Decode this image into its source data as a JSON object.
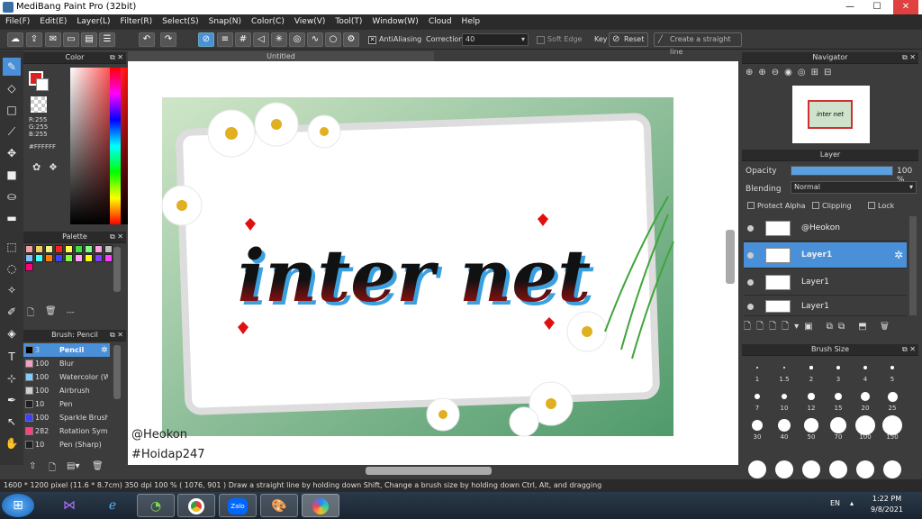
{
  "app": {
    "title": "MediBang Paint Pro (32bit)",
    "controls": [
      "—",
      "☐",
      "✕"
    ]
  },
  "menu": [
    "File(F)",
    "Edit(E)",
    "Layer(L)",
    "Filter(R)",
    "Select(S)",
    "Snap(N)",
    "Color(C)",
    "View(V)",
    "Tool(T)",
    "Window(W)",
    "Cloud",
    "Help"
  ],
  "toolbar": {
    "antialiasing": "AntiAliasing",
    "correction_label": "Correction",
    "correction_value": "40",
    "soft_edge": "Soft Edge",
    "key_label": "Key",
    "reset": "Reset",
    "straight_line": "Create a straight line"
  },
  "color_panel": {
    "title": "Color",
    "r": "R:255",
    "g": "G:255",
    "b": "B:255",
    "hex": "#FFFFFF"
  },
  "palette_panel": {
    "title": "Palette",
    "entry": "---",
    "swatches": [
      "#f4a0a0",
      "#f0d060",
      "#f0f080",
      "#ff2020",
      "#ffff40",
      "#40e040",
      "#80ff80",
      "#ffa0e0",
      "#c0c0c0",
      "#80c0ff",
      "#40ffff",
      "#ff8000",
      "#4040ff",
      "#80ff40",
      "#ffa0ff",
      "#ffff00",
      "#8040ff",
      "#ff40ff",
      "#ff0080"
    ]
  },
  "brush_panel": {
    "title": "Brush: Pencil",
    "items": [
      {
        "size": "3",
        "label": "Pencil",
        "color": "#000"
      },
      {
        "size": "100",
        "label": "Blur",
        "color": "#f0a0c0"
      },
      {
        "size": "100",
        "label": "Watercolor (W",
        "color": "#80d0ff"
      },
      {
        "size": "100",
        "label": "Airbrush",
        "color": "#d0d0d0"
      },
      {
        "size": "10",
        "label": "Pen",
        "color": "#202020"
      },
      {
        "size": "100",
        "label": "Sparkle Brush",
        "color": "#4040ff"
      },
      {
        "size": "282",
        "label": "Rotation Sym",
        "color": "#ff4080"
      },
      {
        "size": "10",
        "label": "Pen (Sharp)",
        "color": "#202020"
      }
    ]
  },
  "canvas": {
    "tab": "Untitled",
    "word": "inter net",
    "sig1": "@Heokon",
    "sig2": "#Hoidap247"
  },
  "navigator": {
    "title": "Navigator",
    "thumb_text": "inter net"
  },
  "layer_panel": {
    "title": "Layer",
    "opacity_label": "Opacity",
    "opacity_value": "100 %",
    "opacity_fraction": 1.0,
    "blending_label": "Blending",
    "blending_value": "Normal",
    "protect_alpha": "Protect Alpha",
    "clipping": "Clipping",
    "lock": "Lock",
    "layers": [
      "@Heokon",
      "Layer1",
      "Layer1",
      "Layer1"
    ]
  },
  "brush_size": {
    "title": "Brush Size",
    "sizes": [
      "1",
      "1.5",
      "2",
      "3",
      "4",
      "5",
      "7",
      "10",
      "12",
      "15",
      "20",
      "25",
      "30",
      "40",
      "50",
      "70",
      "100",
      "150"
    ]
  },
  "status": {
    "text": "1600 * 1200 pixel   (11.6 * 8.7cm)   350 dpi   100 %    ( 1076, 901 )   Draw a straight line by holding down Shift, Change a brush size by holding down Ctrl, Alt, and dragging"
  },
  "taskbar": {
    "lang": "EN",
    "time": "1:22 PM",
    "date": "9/8/2021",
    "apps": [
      "start-icon",
      "visual-studio-icon",
      "ie-icon",
      "coccoc-icon",
      "chrome-icon",
      "zalo-icon",
      "paint-icon",
      "medibang-icon"
    ],
    "zalo": "Zalo"
  }
}
